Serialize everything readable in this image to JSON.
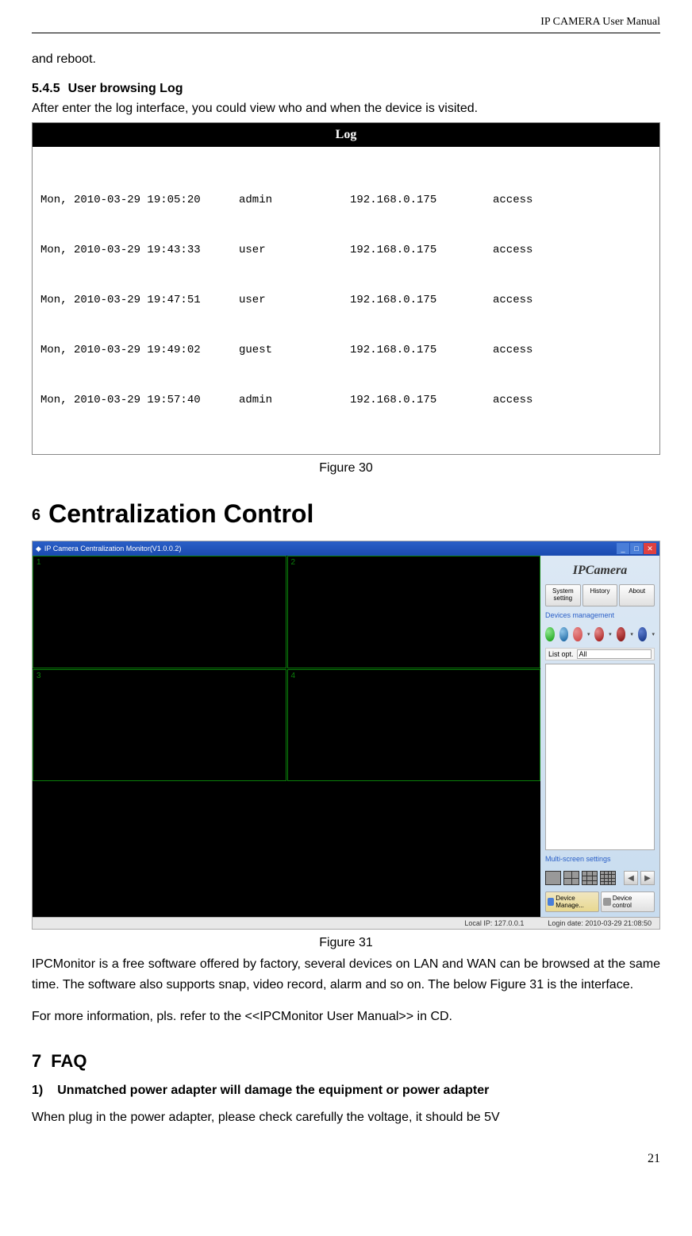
{
  "header": {
    "title": "IP  CAMERA  User  Manual"
  },
  "body": {
    "intro_text": "and reboot.",
    "subsection_545_num": "5.4.5",
    "subsection_545_title": "User browsing Log",
    "subsection_545_text": "After enter the log interface, you could view who and when the device is visited.",
    "figure30_caption": "Figure 30",
    "section6_num": "6",
    "section6_title": "Centralization Control",
    "figure31_caption": "Figure 31",
    "ipc_para1": "IPCMonitor is a free software offered by factory, several devices on LAN and WAN can be browsed at the same time. The software also supports snap, video record, alarm and so on. The below Figure 31 is the interface.",
    "ipc_para2": "For more information, pls. refer to the <<IPCMonitor User Manual>> in CD.",
    "section7_num": "7",
    "section7_title": "FAQ",
    "faq1_num": "1)",
    "faq1_title": "Unmatched power adapter will damage the equipment or power adapter",
    "faq1_text": "When plug in the power adapter, please check carefully the voltage, it should be 5V",
    "page_number": "21"
  },
  "log_screenshot": {
    "header": "Log",
    "rows": [
      {
        "date": "Mon, 2010-03-29 19:05:20",
        "user": "admin",
        "ip": "192.168.0.175",
        "action": "access"
      },
      {
        "date": "Mon, 2010-03-29 19:43:33",
        "user": "user",
        "ip": "192.168.0.175",
        "action": "access"
      },
      {
        "date": "Mon, 2010-03-29 19:47:51",
        "user": "user",
        "ip": "192.168.0.175",
        "action": "access"
      },
      {
        "date": "Mon, 2010-03-29 19:49:02",
        "user": "guest",
        "ip": "192.168.0.175",
        "action": "access"
      },
      {
        "date": "Mon, 2010-03-29 19:57:40",
        "user": "admin",
        "ip": "192.168.0.175",
        "action": "access"
      }
    ]
  },
  "centralization": {
    "window_title": "IP Camera Centralization Monitor(V1.0.0.2)",
    "cells": [
      "1",
      "2",
      "3",
      "4"
    ],
    "logo": "IPCamera",
    "buttons": {
      "system_setting": "System setting",
      "history": "History",
      "about": "About"
    },
    "devices_label": "Devices management",
    "listopt_label": "List opt.",
    "listopt_value": "All",
    "multiscreen_label": "Multi-screen settings",
    "tab_device_manage": "Device Manage...",
    "tab_device_control": "Device control",
    "status_ip": "Local IP:  127.0.0.1",
    "status_login": "Login date: 2010-03-29 21:08:50"
  }
}
